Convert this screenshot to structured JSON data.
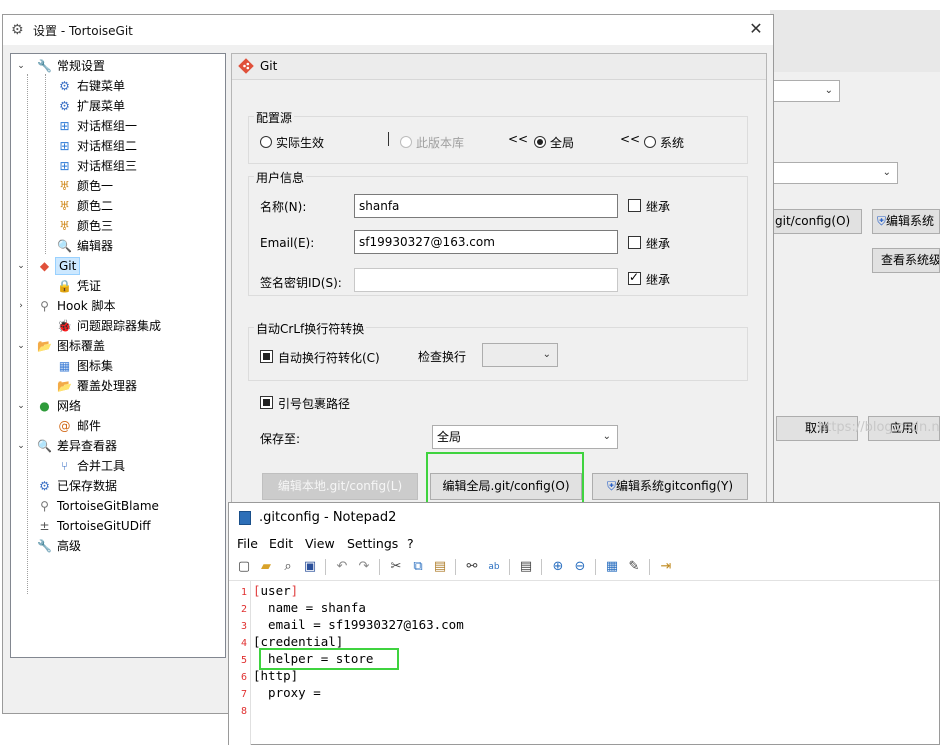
{
  "background_window": {
    "button_global_config": "git/config(O)",
    "button_edit_system": "编辑系统",
    "button_view_system": "查看系统级",
    "button_cancel": "取消",
    "button_apply": "应用(",
    "watermark": "https://blog.csdn.n"
  },
  "settings": {
    "title": "设置 - TortoiseGit",
    "tree": [
      {
        "label": "常规设置",
        "icon": "wrench-icon"
      },
      {
        "label": "右键菜单",
        "icon": "gear-icon"
      },
      {
        "label": "扩展菜单",
        "icon": "gear-icon"
      },
      {
        "label": "对话框组一",
        "icon": "windows-flag-icon"
      },
      {
        "label": "对话框组二",
        "icon": "windows-flag-icon"
      },
      {
        "label": "对话框组三",
        "icon": "windows-flag-icon"
      },
      {
        "label": "颜色一",
        "icon": "palette-icon"
      },
      {
        "label": "颜色二",
        "icon": "palette-icon"
      },
      {
        "label": "颜色三",
        "icon": "palette-icon"
      },
      {
        "label": "编辑器",
        "icon": "magnifier-icon"
      },
      {
        "label": "Git",
        "icon": "git-icon"
      },
      {
        "label": "凭证",
        "icon": "lock-icon"
      },
      {
        "label": "Hook 脚本",
        "icon": "hook-icon"
      },
      {
        "label": "问题跟踪器集成",
        "icon": "bug-icon"
      },
      {
        "label": "图标覆盖",
        "icon": "overlay-icon"
      },
      {
        "label": "图标集",
        "icon": "iconset-icon"
      },
      {
        "label": "覆盖处理器",
        "icon": "overlay-handler-icon"
      },
      {
        "label": "网络",
        "icon": "globe-icon"
      },
      {
        "label": "邮件",
        "icon": "at-icon"
      },
      {
        "label": "差异查看器",
        "icon": "diff-icon"
      },
      {
        "label": "合并工具",
        "icon": "merge-icon"
      },
      {
        "label": "已保存数据",
        "icon": "saved-data-icon"
      },
      {
        "label": "TortoiseGitBlame",
        "icon": "blame-icon"
      },
      {
        "label": "TortoiseGitUDiff",
        "icon": "udiff-icon"
      },
      {
        "label": "高级",
        "icon": "wrench-icon"
      }
    ],
    "panel": {
      "header": "Git",
      "config_source": {
        "label": "配置源",
        "effective": "实际生效",
        "local": "此版本库",
        "global": "全局",
        "system": "系统",
        "arrow": "<<"
      },
      "user_info": {
        "label": "用户信息",
        "name_label": "名称(N):",
        "name_value": "shanfa",
        "email_label": "Email(E):",
        "email_value": "sf19930327@163.com",
        "signkey_label": "签名密钥ID(S):",
        "signkey_value": "",
        "inherit": "继承"
      },
      "crlf": {
        "label": "自动CrLf换行符转换",
        "autocrlf": "自动换行符转化(C)",
        "check_label": "检查换行",
        "check_value": ""
      },
      "quote_path": "引号包裹路径",
      "save_to_label": "保存至:",
      "save_to_value": "全局",
      "buttons": {
        "edit_local": "编辑本地.git/config(L)",
        "edit_global": "编辑全局.git/config(O)",
        "edit_system": "编辑系统gitconfig(Y)"
      }
    }
  },
  "notepad": {
    "title": ".gitconfig - Notepad2",
    "menu": [
      "File",
      "Edit",
      "View",
      "Settings",
      "?"
    ],
    "lines": [
      {
        "num": "1",
        "text": "user"
      },
      {
        "num": "2",
        "text": "  name = shanfa"
      },
      {
        "num": "3",
        "text": "  email = sf19930327@163.com"
      },
      {
        "num": "4",
        "text": "[credential]"
      },
      {
        "num": "5",
        "text": "  helper = store"
      },
      {
        "num": "6",
        "text": "[http]"
      },
      {
        "num": "7",
        "text": "  proxy ="
      },
      {
        "num": "8",
        "text": ""
      }
    ]
  },
  "colors": {
    "highlight": "#3fd33f",
    "selection": "#cce8ff",
    "line_number": "#e03030"
  }
}
